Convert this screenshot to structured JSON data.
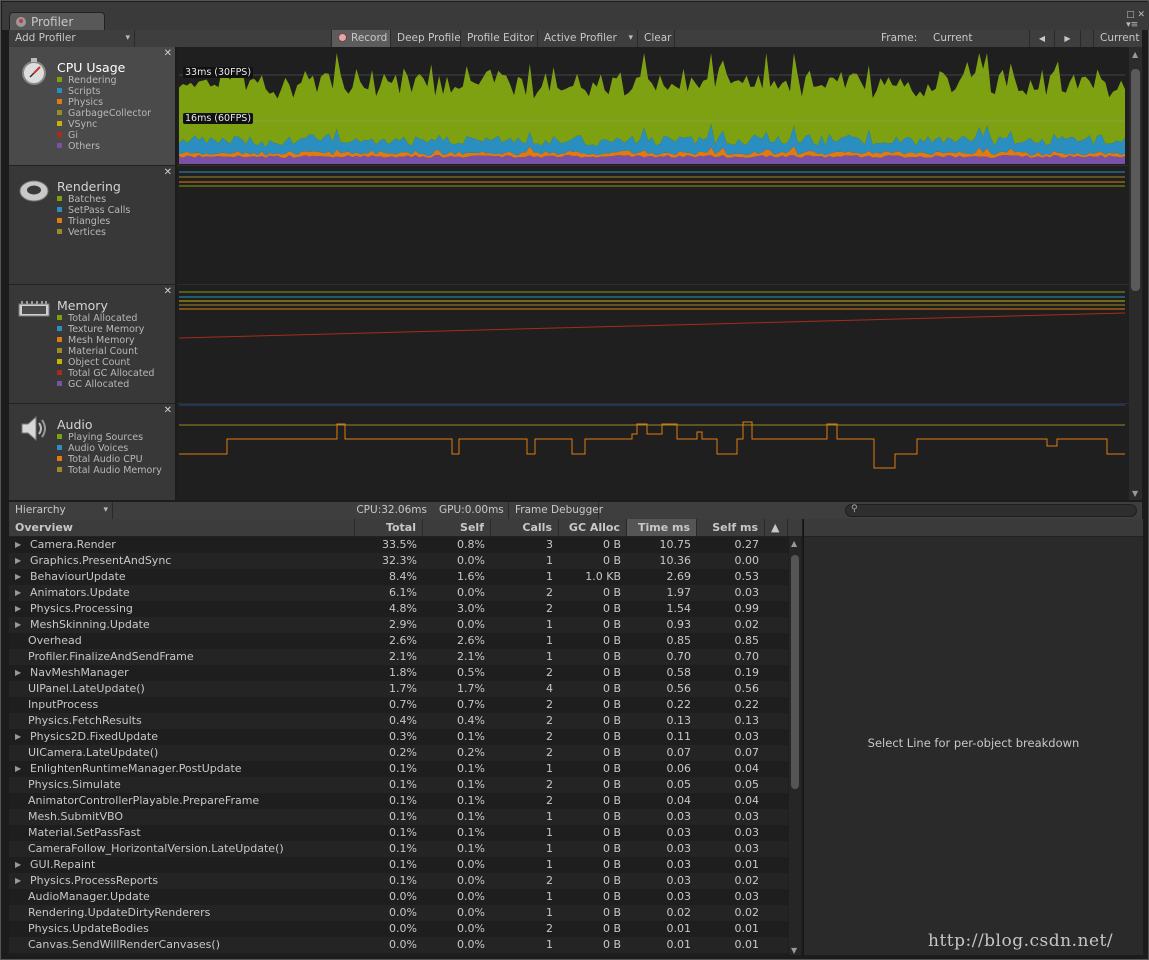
{
  "window": {
    "tab_title": "Profiler",
    "menu_label": "▾≡",
    "close": "□ ✕"
  },
  "toolbar": {
    "add_profiler": "Add Profiler",
    "record": "Record",
    "deep_profile": "Deep Profile",
    "profile_editor": "Profile Editor",
    "active_profiler": "Active Profiler",
    "clear": "Clear",
    "frame_label": "Frame:",
    "frame_value": "Current",
    "prev_icon": "◀",
    "next_icon": "▶",
    "current_btn": "Current"
  },
  "colors": {
    "green": "#8cb80c",
    "blue": "#2a8fc0",
    "orange": "#e07a12",
    "olive": "#9c8a26",
    "yellow": "#c8b400",
    "red": "#a82b1b",
    "purple": "#7952a8"
  },
  "modules": [
    {
      "title": "CPU Usage",
      "icon": "cpu-stopwatch-icon",
      "legend": [
        {
          "label": "Rendering",
          "color": "#7ea112"
        },
        {
          "label": "Scripts",
          "color": "#2a8fc0"
        },
        {
          "label": "Physics",
          "color": "#e07a12"
        },
        {
          "label": "GarbageCollector",
          "color": "#9c8a26"
        },
        {
          "label": "VSync",
          "color": "#c8b400"
        },
        {
          "label": "Gi",
          "color": "#a82b1b"
        },
        {
          "label": "Others",
          "color": "#7952a8"
        }
      ]
    },
    {
      "title": "Rendering",
      "icon": "rendering-disk-icon",
      "legend": [
        {
          "label": "Batches",
          "color": "#7ea112"
        },
        {
          "label": "SetPass Calls",
          "color": "#2a8fc0"
        },
        {
          "label": "Triangles",
          "color": "#e07a12"
        },
        {
          "label": "Vertices",
          "color": "#9c8a26"
        }
      ]
    },
    {
      "title": "Memory",
      "icon": "memory-chip-icon",
      "legend": [
        {
          "label": "Total Allocated",
          "color": "#7ea112"
        },
        {
          "label": "Texture Memory",
          "color": "#2a8fc0"
        },
        {
          "label": "Mesh Memory",
          "color": "#e07a12"
        },
        {
          "label": "Material Count",
          "color": "#9c8a26"
        },
        {
          "label": "Object Count",
          "color": "#c8b400"
        },
        {
          "label": "Total GC Allocated",
          "color": "#a82b1b"
        },
        {
          "label": "GC Allocated",
          "color": "#7952a8"
        }
      ]
    },
    {
      "title": "Audio",
      "icon": "audio-speaker-icon",
      "legend": [
        {
          "label": "Playing Sources",
          "color": "#7ea112"
        },
        {
          "label": "Audio Voices",
          "color": "#2a8fc0"
        },
        {
          "label": "Total Audio CPU",
          "color": "#e07a12"
        },
        {
          "label": "Total Audio Memory",
          "color": "#9c8a26"
        }
      ]
    }
  ],
  "cpu_markers": {
    "ms33": "33ms (30FPS)",
    "ms16": "16ms (60FPS)"
  },
  "hierarchy_bar": {
    "view": "Hierarchy",
    "cpu": "CPU:32.06ms",
    "gpu": "GPU:0.00ms",
    "frame_debugger": "Frame Debugger"
  },
  "table": {
    "headers": [
      "Overview",
      "Total",
      "Self",
      "Calls",
      "GC Alloc",
      "Time ms",
      "Self ms",
      "▲"
    ],
    "rows": [
      {
        "name": "Camera.Render",
        "exp": true,
        "total": "33.5%",
        "self": "0.8%",
        "calls": "3",
        "gc": "0 B",
        "time": "10.75",
        "selfms": "0.27"
      },
      {
        "name": "Graphics.PresentAndSync",
        "exp": true,
        "total": "32.3%",
        "self": "0.0%",
        "calls": "1",
        "gc": "0 B",
        "time": "10.36",
        "selfms": "0.00"
      },
      {
        "name": "BehaviourUpdate",
        "exp": true,
        "total": "8.4%",
        "self": "1.6%",
        "calls": "1",
        "gc": "1.0 KB",
        "time": "2.69",
        "selfms": "0.53"
      },
      {
        "name": "Animators.Update",
        "exp": true,
        "total": "6.1%",
        "self": "0.0%",
        "calls": "2",
        "gc": "0 B",
        "time": "1.97",
        "selfms": "0.03"
      },
      {
        "name": "Physics.Processing",
        "exp": true,
        "total": "4.8%",
        "self": "3.0%",
        "calls": "2",
        "gc": "0 B",
        "time": "1.54",
        "selfms": "0.99"
      },
      {
        "name": "MeshSkinning.Update",
        "exp": true,
        "total": "2.9%",
        "self": "0.0%",
        "calls": "1",
        "gc": "0 B",
        "time": "0.93",
        "selfms": "0.02"
      },
      {
        "name": "Overhead",
        "exp": false,
        "total": "2.6%",
        "self": "2.6%",
        "calls": "1",
        "gc": "0 B",
        "time": "0.85",
        "selfms": "0.85"
      },
      {
        "name": "Profiler.FinalizeAndSendFrame",
        "exp": false,
        "total": "2.1%",
        "self": "2.1%",
        "calls": "1",
        "gc": "0 B",
        "time": "0.70",
        "selfms": "0.70"
      },
      {
        "name": "NavMeshManager",
        "exp": true,
        "total": "1.8%",
        "self": "0.5%",
        "calls": "2",
        "gc": "0 B",
        "time": "0.58",
        "selfms": "0.19"
      },
      {
        "name": "UIPanel.LateUpdate()",
        "exp": false,
        "total": "1.7%",
        "self": "1.7%",
        "calls": "4",
        "gc": "0 B",
        "time": "0.56",
        "selfms": "0.56"
      },
      {
        "name": "InputProcess",
        "exp": false,
        "total": "0.7%",
        "self": "0.7%",
        "calls": "2",
        "gc": "0 B",
        "time": "0.22",
        "selfms": "0.22"
      },
      {
        "name": "Physics.FetchResults",
        "exp": false,
        "total": "0.4%",
        "self": "0.4%",
        "calls": "2",
        "gc": "0 B",
        "time": "0.13",
        "selfms": "0.13"
      },
      {
        "name": "Physics2D.FixedUpdate",
        "exp": true,
        "total": "0.3%",
        "self": "0.1%",
        "calls": "2",
        "gc": "0 B",
        "time": "0.11",
        "selfms": "0.03"
      },
      {
        "name": "UICamera.LateUpdate()",
        "exp": false,
        "total": "0.2%",
        "self": "0.2%",
        "calls": "2",
        "gc": "0 B",
        "time": "0.07",
        "selfms": "0.07"
      },
      {
        "name": "EnlightenRuntimeManager.PostUpdate",
        "exp": true,
        "total": "0.1%",
        "self": "0.1%",
        "calls": "1",
        "gc": "0 B",
        "time": "0.06",
        "selfms": "0.04"
      },
      {
        "name": "Physics.Simulate",
        "exp": false,
        "total": "0.1%",
        "self": "0.1%",
        "calls": "2",
        "gc": "0 B",
        "time": "0.05",
        "selfms": "0.05"
      },
      {
        "name": "AnimatorControllerPlayable.PrepareFrame",
        "exp": false,
        "total": "0.1%",
        "self": "0.1%",
        "calls": "2",
        "gc": "0 B",
        "time": "0.04",
        "selfms": "0.04"
      },
      {
        "name": "Mesh.SubmitVBO",
        "exp": false,
        "total": "0.1%",
        "self": "0.1%",
        "calls": "1",
        "gc": "0 B",
        "time": "0.03",
        "selfms": "0.03"
      },
      {
        "name": "Material.SetPassFast",
        "exp": false,
        "total": "0.1%",
        "self": "0.1%",
        "calls": "1",
        "gc": "0 B",
        "time": "0.03",
        "selfms": "0.03"
      },
      {
        "name": "CameraFollow_HorizontalVersion.LateUpdate()",
        "exp": false,
        "total": "0.1%",
        "self": "0.1%",
        "calls": "1",
        "gc": "0 B",
        "time": "0.03",
        "selfms": "0.03"
      },
      {
        "name": "GUI.Repaint",
        "exp": true,
        "total": "0.1%",
        "self": "0.0%",
        "calls": "1",
        "gc": "0 B",
        "time": "0.03",
        "selfms": "0.01"
      },
      {
        "name": "Physics.ProcessReports",
        "exp": true,
        "total": "0.1%",
        "self": "0.0%",
        "calls": "2",
        "gc": "0 B",
        "time": "0.03",
        "selfms": "0.02"
      },
      {
        "name": "AudioManager.Update",
        "exp": false,
        "total": "0.0%",
        "self": "0.0%",
        "calls": "1",
        "gc": "0 B",
        "time": "0.03",
        "selfms": "0.03"
      },
      {
        "name": "Rendering.UpdateDirtyRenderers",
        "exp": false,
        "total": "0.0%",
        "self": "0.0%",
        "calls": "1",
        "gc": "0 B",
        "time": "0.02",
        "selfms": "0.02"
      },
      {
        "name": "Physics.UpdateBodies",
        "exp": false,
        "total": "0.0%",
        "self": "0.0%",
        "calls": "2",
        "gc": "0 B",
        "time": "0.01",
        "selfms": "0.01"
      },
      {
        "name": "Canvas.SendWillRenderCanvases()",
        "exp": false,
        "total": "0.0%",
        "self": "0.0%",
        "calls": "1",
        "gc": "0 B",
        "time": "0.01",
        "selfms": "0.01"
      }
    ]
  },
  "detail": {
    "message": "Select Line for per-object breakdown"
  },
  "watermark": "http://blog.csdn.net/"
}
